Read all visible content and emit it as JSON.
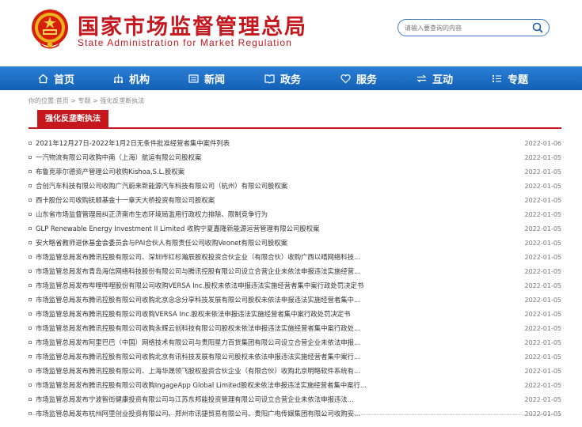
{
  "header": {
    "title_cn": "国家市场监督管理总局",
    "title_en": "State Administration for Market Regulation",
    "search_placeholder": "请输入要查询的内容"
  },
  "nav": [
    {
      "label": "首页",
      "icon": "home-icon"
    },
    {
      "label": "机构",
      "icon": "org-icon"
    },
    {
      "label": "新闻",
      "icon": "news-icon"
    },
    {
      "label": "政务",
      "icon": "gov-icon"
    },
    {
      "label": "服务",
      "icon": "heart-icon"
    },
    {
      "label": "互动",
      "icon": "arrows-icon"
    },
    {
      "label": "专题",
      "icon": "list-icon"
    }
  ],
  "breadcrumb": "你的位置:首页 > 专题 > 强化反垄断执法",
  "panel_title": "强化反垄断执法",
  "items": [
    {
      "title": "2021年12月27日-2022年1月2日无条件批准经营者集中案件列表",
      "date": "2022-01-06"
    },
    {
      "title": "一汽物流有限公司收购中南（上海）航运有限公司股权案",
      "date": "2022-01-05"
    },
    {
      "title": "布鲁克菲尔德资产管理公司收购Kishoa,S.L.股权案",
      "date": "2022-01-05"
    },
    {
      "title": "合创汽车科技有限公司收购广汽蔚来新能源汽车科技有限公司（杭州）有限公司股权案",
      "date": "2022-01-05"
    },
    {
      "title": "西卡股份公司收购抚顺基金十一章天大桥投资有限公司股权案",
      "date": "2022-01-05"
    },
    {
      "title": "山东省市场监督管理局纠正济南市生态环境局滥用行政权力排除、限制竞争行为",
      "date": "2022-01-05"
    },
    {
      "title": "GLP Renewable Energy Investment II Limited 收购宁夏嘉隆新能源运营管理有限公司股权案",
      "date": "2022-01-05"
    },
    {
      "title": "安大略省教师退休基金会委员会与PAI合伙人有限责任公司收购Veonet有限公司股权案",
      "date": "2022-01-05"
    },
    {
      "title": "市场监管总局发布腾讯控股有限公司、深圳市红杉瀚辰股权投资合伙企业（有限合伙）收购广西以晴网络科技...",
      "date": "2022-01-05"
    },
    {
      "title": "市场监管总局发布青岛海信网络科技股份有限公司与腾讯控股有限公司设立合营企业未依法申报违法实施经营...",
      "date": "2022-01-05"
    },
    {
      "title": "市场监管总局发布哔哩哔哩股份有限公司收购VERSA Inc.股权未依法申报违法实施经营者集中案行政处罚决定书",
      "date": "2022-01-05"
    },
    {
      "title": "市场监管总局发布腾讯控股有限公司收购北京念念分享科技发展有限公司股权未依法申报违法实施经营者集中...",
      "date": "2022-01-05"
    },
    {
      "title": "市场监管总局发布腾讯控股有限公司收购VERSA Inc.股权未依法申报违法实施经营者集中案行政处罚决定书",
      "date": "2022-01-05"
    },
    {
      "title": "市场监管总局发布腾讯控股有限公司收购永辉云创科技有限公司股权未依法申报违法实施经营者集中案行政处...",
      "date": "2022-01-05"
    },
    {
      "title": "市场监管总局发布阿里巴巴（中国）网络技术有限公司与贵阳星力百货集团有限公司设立合营企业未依法申报...",
      "date": "2022-01-05"
    },
    {
      "title": "市场监管总局发布腾讯控股有限公司收购北京有讯科技发展有限公司股权未依法申报违法实施经营者集中案行...",
      "date": "2022-01-05"
    },
    {
      "title": "市场监管总局发布腾讯控股有限公司、上海华晟领飞股权投资合伙企业（有限合伙）收购北京明略软件系统有...",
      "date": "2022-01-05"
    },
    {
      "title": "市场监管总局发布腾讯控股有限公司收购IngageApp Global Limited股权未依法申报违法实施经营者集中案行...",
      "date": "2022-01-05"
    },
    {
      "title": "市场监管总局发布宁波智街健康投资有限公司与江苏东邦能投资管理有限公司设立合营企业未依法申报违法...",
      "date": "2022-01-05"
    },
    {
      "title": "市场监管总局发布杭州阿里创业投资有限公司、郑州市讯捷贸易有限公司、贵阳广电传媒集团有限公司收购安...",
      "date": "2022-01-05"
    }
  ]
}
